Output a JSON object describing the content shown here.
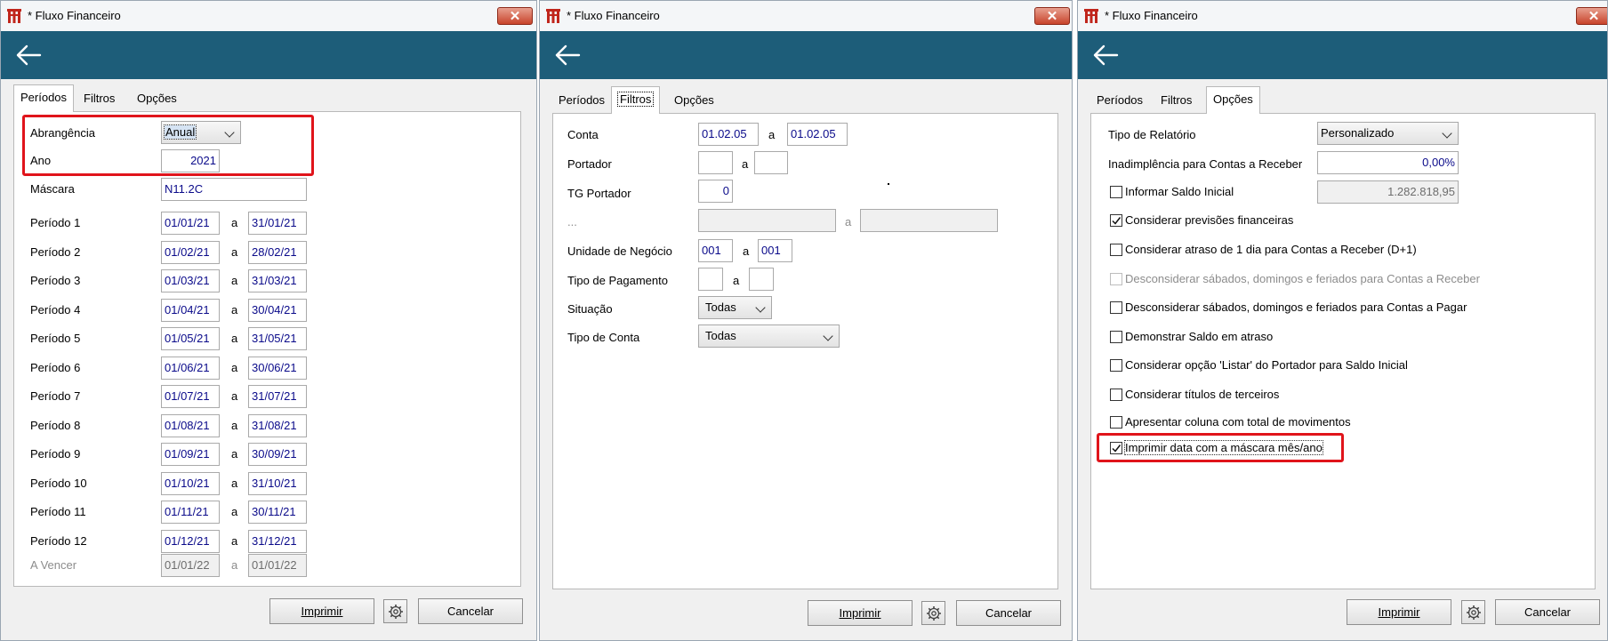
{
  "window_title": "* Fluxo Financeiro",
  "close_label": "✕",
  "tabs": {
    "periodos": "Períodos",
    "filtros": "Filtros",
    "opcoes": "Opções"
  },
  "buttons": {
    "imprimir": "Imprimir",
    "cancelar": "Cancelar"
  },
  "periodos": {
    "abrangencia_label": "Abrangência",
    "abrangencia_value": "Anual",
    "ano_label": "Ano",
    "ano_value": "2021",
    "mascara_label": "Máscara",
    "mascara_value": "N11.2C",
    "separator": "a",
    "periods": [
      {
        "label": "Período 1",
        "from": "01/01/21",
        "to": "31/01/21"
      },
      {
        "label": "Período 2",
        "from": "01/02/21",
        "to": "28/02/21"
      },
      {
        "label": "Período 3",
        "from": "01/03/21",
        "to": "31/03/21"
      },
      {
        "label": "Período 4",
        "from": "01/04/21",
        "to": "30/04/21"
      },
      {
        "label": "Período 5",
        "from": "01/05/21",
        "to": "31/05/21"
      },
      {
        "label": "Período 6",
        "from": "01/06/21",
        "to": "30/06/21"
      },
      {
        "label": "Período 7",
        "from": "01/07/21",
        "to": "31/07/21"
      },
      {
        "label": "Período 8",
        "from": "01/08/21",
        "to": "31/08/21"
      },
      {
        "label": "Período 9",
        "from": "01/09/21",
        "to": "30/09/21"
      },
      {
        "label": "Período 10",
        "from": "01/10/21",
        "to": "31/10/21"
      },
      {
        "label": "Período 11",
        "from": "01/11/21",
        "to": "30/11/21"
      },
      {
        "label": "Período 12",
        "from": "01/12/21",
        "to": "31/12/21"
      }
    ],
    "a_vencer": {
      "label": "A Vencer",
      "from": "01/01/22",
      "to": "01/01/22"
    }
  },
  "filtros": {
    "separator": "a",
    "conta_label": "Conta",
    "conta_from": "01.02.05",
    "conta_to": "01.02.05",
    "portador_label": "Portador",
    "portador_from": "",
    "portador_to": "",
    "tg_portador_label": "TG Portador",
    "tg_portador_value": "0",
    "ellipsis_label": "...",
    "ellipsis_from": "",
    "ellipsis_to": "",
    "unidade_label": "Unidade de Negócio",
    "unidade_from": "001",
    "unidade_to": "001",
    "tipo_pagamento_label": "Tipo de Pagamento",
    "tipo_pagamento_from": "",
    "tipo_pagamento_to": "",
    "situacao_label": "Situação",
    "situacao_value": "Todas",
    "tipo_conta_label": "Tipo de Conta",
    "tipo_conta_value": "Todas"
  },
  "opcoes": {
    "tipo_relatorio_label": "Tipo de Relatório",
    "tipo_relatorio_value": "Personalizado",
    "inadimplencia_label": "Inadimplência para Contas a Receber",
    "inadimplencia_value": "0,00%",
    "saldo_inicial_value": "1.282.818,95",
    "checkboxes": [
      {
        "label": "Informar Saldo Inicial",
        "checked": false,
        "enabled": true
      },
      {
        "label": "Considerar previsões financeiras",
        "checked": true,
        "enabled": true
      },
      {
        "label": "Considerar atraso de 1 dia para Contas a Receber (D+1)",
        "checked": false,
        "enabled": true
      },
      {
        "label": "Desconsiderar sábados, domingos e feriados para Contas a Receber",
        "checked": false,
        "enabled": false
      },
      {
        "label": "Desconsiderar sábados, domingos e feriados para Contas a Pagar",
        "checked": false,
        "enabled": true
      },
      {
        "label": "Demonstrar Saldo em atraso",
        "checked": false,
        "enabled": true
      },
      {
        "label": "Considerar opção 'Listar' do Portador para Saldo Inicial",
        "checked": false,
        "enabled": true
      },
      {
        "label": "Considerar títulos de terceiros",
        "checked": false,
        "enabled": true
      },
      {
        "label": "Apresentar coluna com total de movimentos",
        "checked": false,
        "enabled": true
      },
      {
        "label": "Imprimir data com a máscara mês/ano",
        "checked": true,
        "enabled": true
      }
    ]
  },
  "colors": {
    "header": "#1d5d79",
    "highlight": "#e0141b",
    "input_text": "#0a0a8a"
  },
  "icons": {
    "app": "app-logo-icon",
    "back": "arrow-left-icon",
    "close": "close-icon",
    "settings": "gear-icon"
  }
}
